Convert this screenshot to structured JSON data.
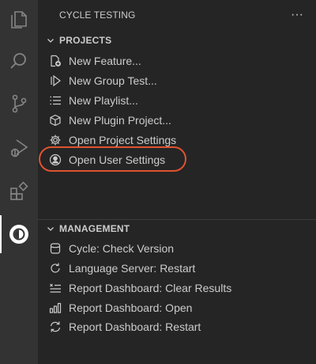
{
  "sidebar": {
    "title": "CYCLE TESTING",
    "more_icon": "ellipsis-icon"
  },
  "activity_bar": {
    "items": [
      {
        "icon": "files-icon"
      },
      {
        "icon": "search-icon"
      },
      {
        "icon": "source-control-icon"
      },
      {
        "icon": "run-debug-icon"
      },
      {
        "icon": "extensions-icon"
      },
      {
        "icon": "cycle-icon",
        "active": true
      }
    ]
  },
  "projects": {
    "title": "PROJECTS",
    "items": [
      {
        "label": "New Feature...",
        "icon": "new-file-icon"
      },
      {
        "label": "New Group Test...",
        "icon": "group-test-icon"
      },
      {
        "label": "New Playlist...",
        "icon": "list-icon"
      },
      {
        "label": "New Plugin Project...",
        "icon": "package-icon"
      },
      {
        "label": "Open Project Settings",
        "icon": "gear-icon"
      },
      {
        "label": "Open User Settings",
        "icon": "account-icon"
      }
    ]
  },
  "management": {
    "title": "MANAGEMENT",
    "items": [
      {
        "label": "Cycle: Check Version",
        "icon": "database-icon"
      },
      {
        "label": "Language Server: Restart",
        "icon": "refresh-icon"
      },
      {
        "label": "Report Dashboard: Clear Results",
        "icon": "clear-list-icon"
      },
      {
        "label": "Report Dashboard: Open",
        "icon": "graph-icon"
      },
      {
        "label": "Report Dashboard: Restart",
        "icon": "sync-icon"
      }
    ]
  },
  "colors": {
    "activity_bar": "#333333",
    "sidebar": "#252526",
    "text": "#cccccc",
    "highlight": "#e0532e"
  }
}
